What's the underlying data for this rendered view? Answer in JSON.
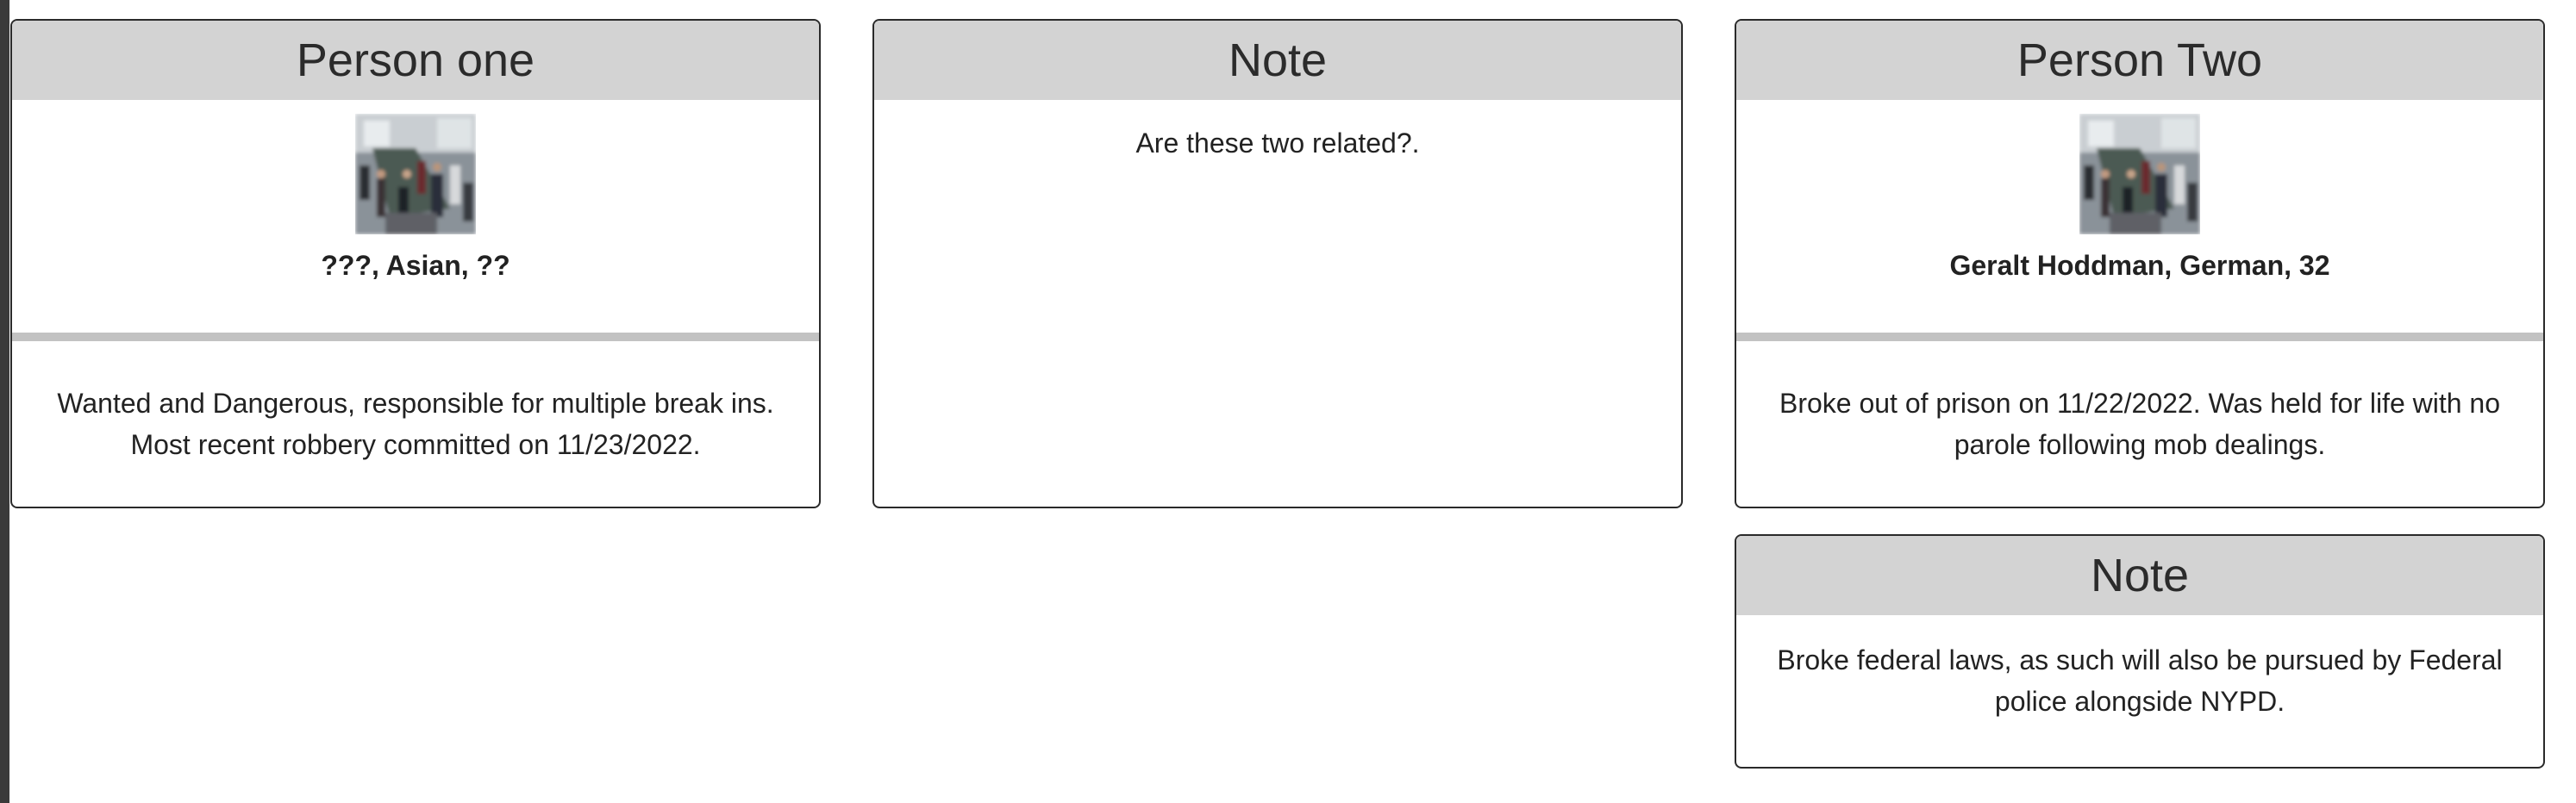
{
  "cards": {
    "person_one": {
      "title": "Person one",
      "subject": "???, Asian, ??",
      "description": "Wanted and Dangerous, responsible for multiple break ins. Most recent robbery committed on 11/23/2022."
    },
    "note_one": {
      "title": "Note",
      "text": "Are these two related?."
    },
    "person_two": {
      "title": "Person Two",
      "subject": "Geralt Hoddman, German, 32",
      "description": "Broke out of prison on 11/22/2022. Was held for life with no parole following mob dealings."
    },
    "note_two": {
      "title": "Note",
      "text": "Broke federal laws, as such will also be pursued by Federal police alongside NYPD."
    }
  },
  "icons": {
    "photo": "crowd-photo"
  }
}
